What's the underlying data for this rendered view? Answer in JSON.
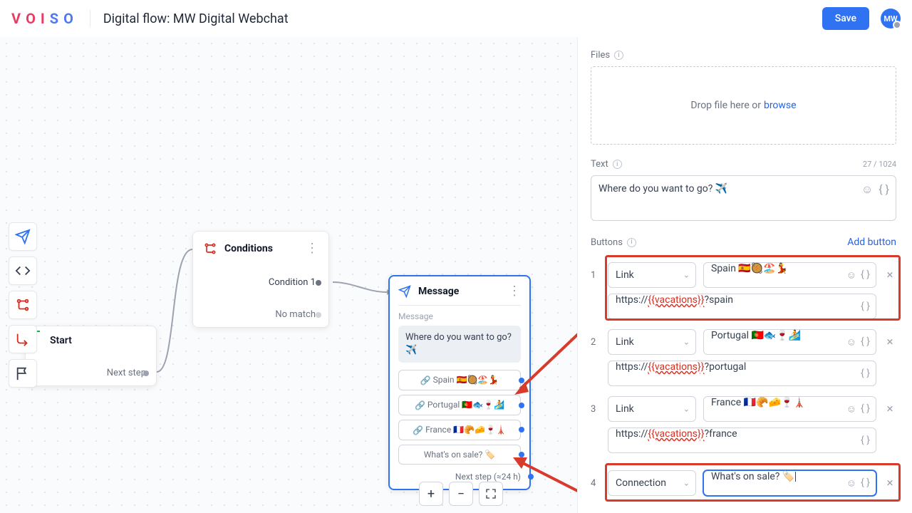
{
  "header": {
    "title": "Digital flow: MW Digital Webchat",
    "save": "Save",
    "avatar": "MW"
  },
  "canvas": {
    "start": {
      "title": "Start",
      "next": "Next step"
    },
    "conditions": {
      "title": "Conditions",
      "cond1": "Condition 1",
      "nomatch": "No match"
    },
    "message": {
      "title": "Message",
      "section": "Message",
      "bubble": "Where do you want to go? ✈️",
      "buttons": [
        "Spain 🇪🇸🥘🏖️💃",
        "Portugal 🇵🇹🐟🍷🏄",
        "France 🇫🇷🥐🧀🍷🗼",
        "What's on sale? 🏷️"
      ],
      "next": "Next step (≈24 h)"
    },
    "zoom": {
      "plus": "+",
      "minus": "−"
    }
  },
  "panel": {
    "files": {
      "label": "Files",
      "drop": "Drop file here or",
      "browse": "browse"
    },
    "text": {
      "label": "Text",
      "counter": "27 / 1024",
      "value": "Where do you want to go? ✈️"
    },
    "buttons": {
      "label": "Buttons",
      "add": "Add button",
      "rows": [
        {
          "n": "1",
          "type": "Link",
          "title": "Spain 🇪🇸🥘🏖️💃",
          "url_pre": "https://",
          "url_var": "{{vacations}}",
          "url_post": "?spain"
        },
        {
          "n": "2",
          "type": "Link",
          "title": "Portugal 🇵🇹🐟🍷🏄",
          "url_pre": "https://",
          "url_var": "{{vacations}}",
          "url_post": "?portugal"
        },
        {
          "n": "3",
          "type": "Link",
          "title": "France 🇫🇷🥐🧀🍷🗼",
          "url_pre": "https://",
          "url_var": "{{vacations}}",
          "url_post": "?france"
        },
        {
          "n": "4",
          "type": "Connection",
          "title": "What's on sale? 🏷️"
        }
      ]
    }
  },
  "chart_data": null
}
